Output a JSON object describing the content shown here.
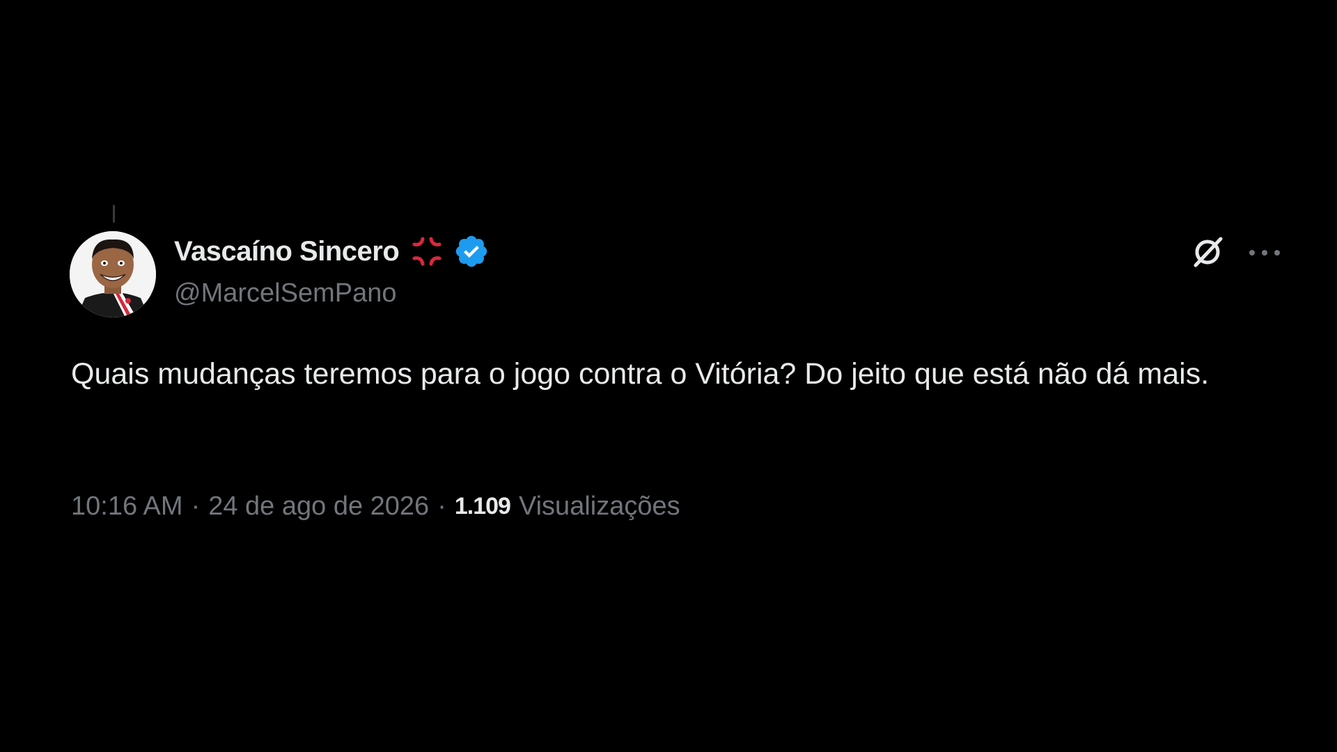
{
  "tweet": {
    "author": {
      "display_name": "Vascaíno Sincero",
      "handle": "@MarcelSemPano",
      "badge_emoji_icon": "anger-symbol-icon",
      "verified_icon": "verified-badge-icon",
      "verified_color": "#1d9bf0"
    },
    "actions": {
      "grok_icon": "grok-icon",
      "more_icon": "more-options-icon"
    },
    "text": "Quais mudanças teremos para o jogo contra o Vitória? Do jeito que está não dá mais.",
    "meta": {
      "time": "10:16 AM",
      "separator": "·",
      "date": "24 de ago de 2026",
      "views_count": "1.109",
      "views_label": "Visualizações"
    }
  },
  "colors": {
    "background": "#000000",
    "primary_text": "#e7e9ea",
    "secondary_text": "#71767b",
    "accent_red": "#d8283c"
  }
}
